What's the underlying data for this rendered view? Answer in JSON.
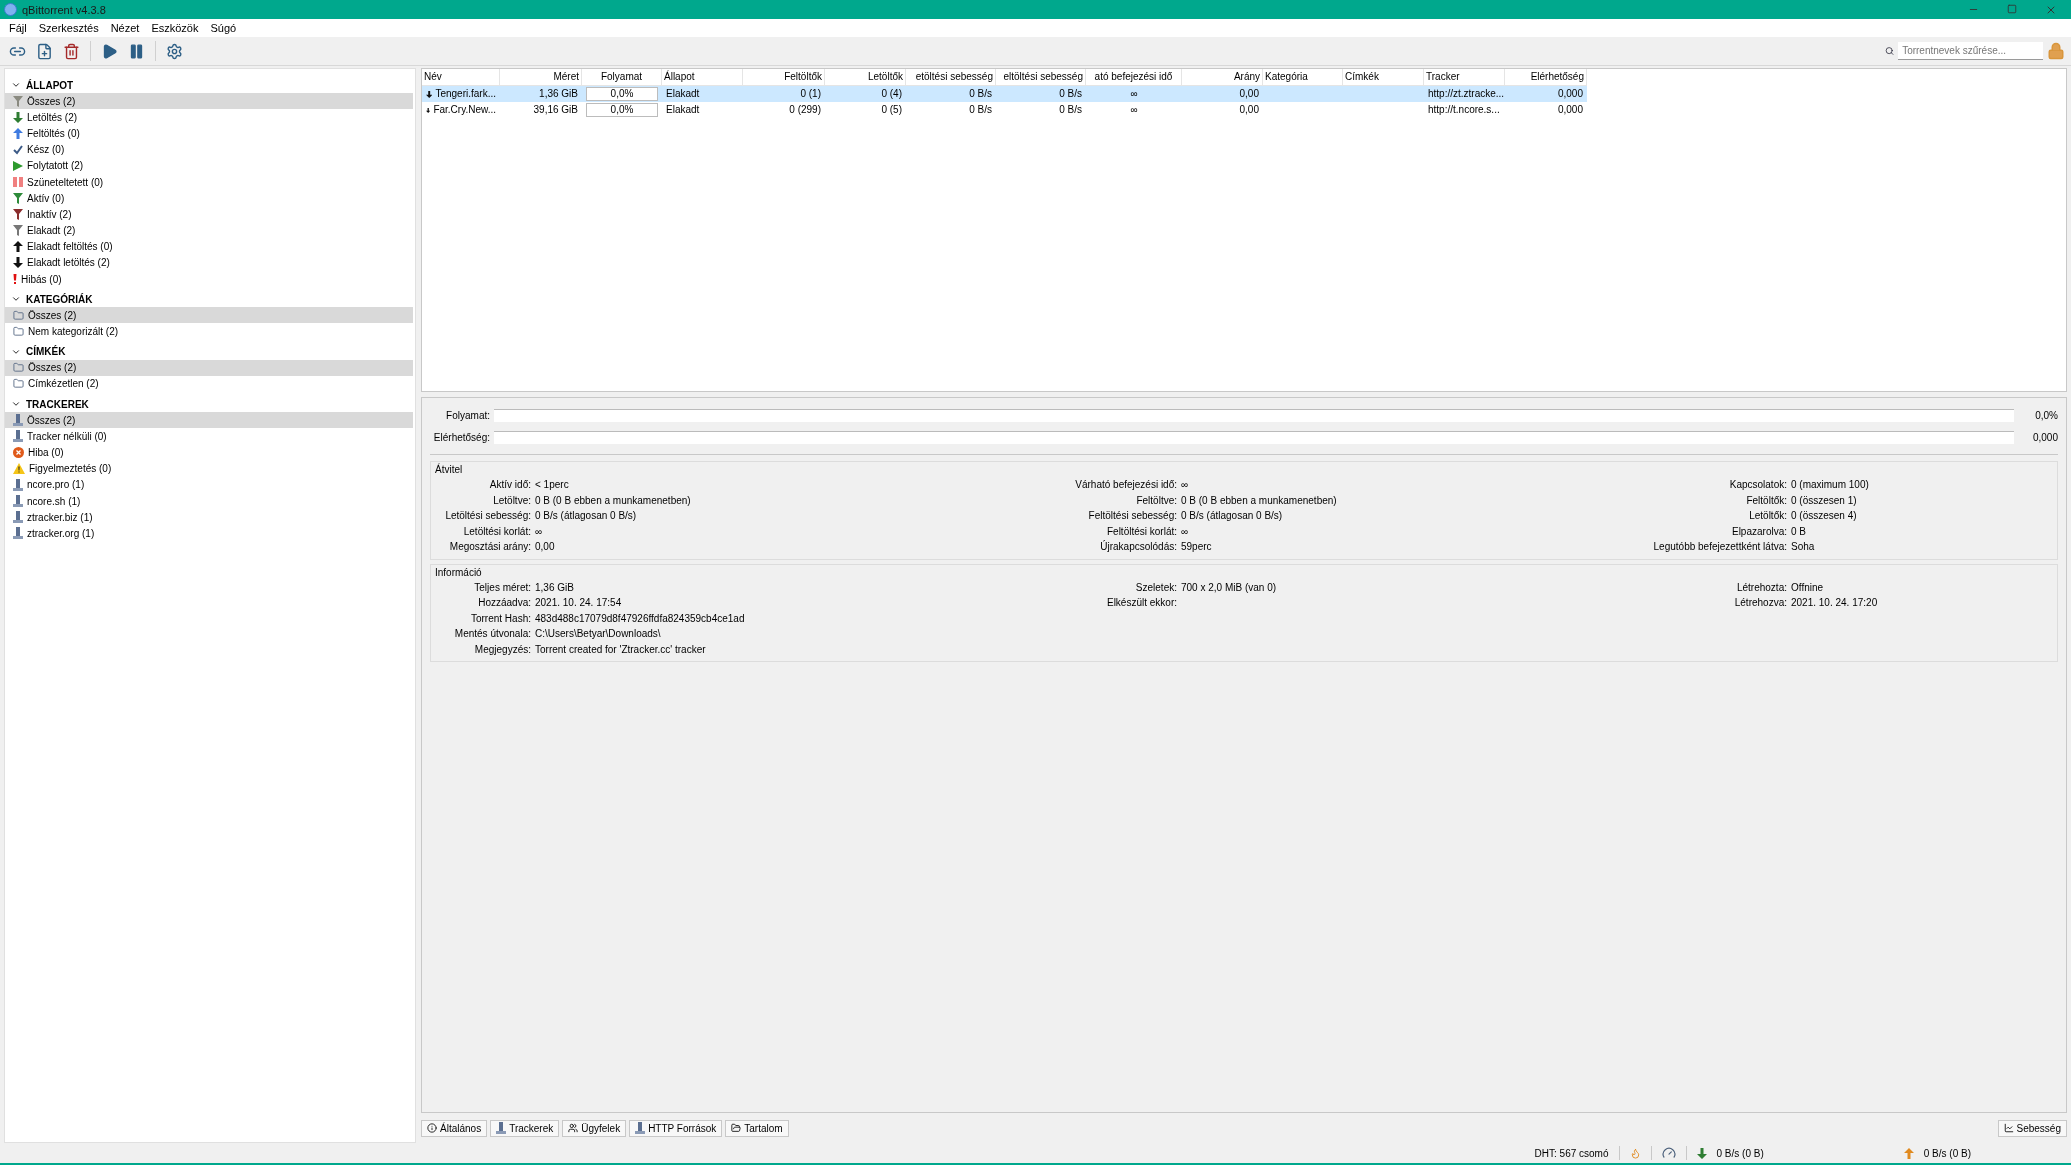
{
  "window": {
    "title": "qBittorrent v4.3.8"
  },
  "menu": [
    "Fájl",
    "Szerkesztés",
    "Nézet",
    "Eszközök",
    "Súgó"
  ],
  "toolbar": {
    "search": {
      "placeholder": "Torrentnevek szűrése..."
    }
  },
  "sidebar": {
    "sections": [
      {
        "title": "ÁLLAPOT",
        "expanded": true,
        "items": [
          {
            "label": "Összes (2)",
            "kind": "all",
            "selected": true
          },
          {
            "label": "Letöltés (2)",
            "kind": "downloading",
            "selected": false
          },
          {
            "label": "Feltöltés (0)",
            "kind": "seeding",
            "selected": false
          },
          {
            "label": "Kész (0)",
            "kind": "completed",
            "selected": false
          },
          {
            "label": "Folytatott (2)",
            "kind": "resumed",
            "selected": false
          },
          {
            "label": "Szüneteltetett (0)",
            "kind": "paused",
            "selected": false
          },
          {
            "label": "Aktív (0)",
            "kind": "active",
            "selected": false
          },
          {
            "label": "Inaktív (2)",
            "kind": "inactive",
            "selected": false
          },
          {
            "label": "Elakadt (2)",
            "kind": "stalled",
            "selected": false
          },
          {
            "label": "Elakadt feltöltés (0)",
            "kind": "stalledup",
            "selected": false
          },
          {
            "label": "Elakadt letöltés (2)",
            "kind": "stalleddown",
            "selected": false
          },
          {
            "label": "Hibás (0)",
            "kind": "errored",
            "selected": false
          }
        ]
      },
      {
        "title": "KATEGÓRIÁK",
        "expanded": true,
        "items": [
          {
            "label": "Összes (2)",
            "kind": "folder",
            "selected": true
          },
          {
            "label": "Nem kategorizált (2)",
            "kind": "folder",
            "selected": false
          }
        ]
      },
      {
        "title": "CÍMKÉK",
        "expanded": true,
        "items": [
          {
            "label": "Összes (2)",
            "kind": "folder",
            "selected": true
          },
          {
            "label": "Címkézetlen (2)",
            "kind": "folder",
            "selected": false
          }
        ]
      },
      {
        "title": "TRACKEREK",
        "expanded": true,
        "items": [
          {
            "label": "Összes (2)",
            "kind": "tracker",
            "selected": true
          },
          {
            "label": "Tracker nélküli (0)",
            "kind": "tracker",
            "selected": false
          },
          {
            "label": "Hiba (0)",
            "kind": "error",
            "selected": false
          },
          {
            "label": "Figyelmeztetés (0)",
            "kind": "warning",
            "selected": false
          },
          {
            "label": "ncore.pro (1)",
            "kind": "tracker",
            "selected": false
          },
          {
            "label": "ncore.sh (1)",
            "kind": "tracker",
            "selected": false
          },
          {
            "label": "ztracker.biz (1)",
            "kind": "tracker",
            "selected": false
          },
          {
            "label": "ztracker.org (1)",
            "kind": "tracker",
            "selected": false
          }
        ]
      }
    ]
  },
  "table": {
    "columns": [
      "Név",
      "Méret",
      "Folyamat",
      "Állapot",
      "Feltöltők",
      "Letöltők",
      "etöltési sebesség",
      "eltöltési sebesség",
      "ató befejezési idő",
      "Arány",
      "Kategória",
      "Címkék",
      "Tracker",
      "Elérhetőség"
    ],
    "rows": [
      {
        "selected": true,
        "name": "Tengeri.fark...",
        "size": "1,36 GiB",
        "progress": {
          "level": 0,
          "text": "0,0%"
        },
        "status": "Elakadt",
        "seeds": "0 (1)",
        "peers": "0 (4)",
        "down_speed": "0 B/s",
        "up_speed": "0 B/s",
        "eta": "∞",
        "ratio": "0,00",
        "tracker": "http://zt.ztracke...",
        "availability": "0,000"
      },
      {
        "selected": false,
        "name": "Far.Cry.New...",
        "size": "39,16 GiB",
        "progress": {
          "level": 0,
          "text": "0,0%"
        },
        "status": "Elakadt",
        "seeds": "0 (299)",
        "peers": "0 (5)",
        "down_speed": "0 B/s",
        "up_speed": "0 B/s",
        "eta": "∞",
        "ratio": "0,00",
        "tracker": "http://t.ncore.s...",
        "availability": "0,000"
      }
    ]
  },
  "details": {
    "bars": [
      {
        "label": "Folyamat:",
        "level": 0,
        "value": "0,0%"
      },
      {
        "label": "Elérhetőség:",
        "level": 0,
        "value": "0,000"
      }
    ],
    "groups": [
      {
        "title": "Átvitel",
        "rows": [
          [
            {
              "label": "Aktív idő:",
              "value": "< 1perc"
            },
            {
              "label": "Várható befejezési idő:",
              "value": "∞"
            },
            {
              "label": "Kapcsolatok:",
              "value": "0 (maximum 100)"
            }
          ],
          [
            {
              "label": "Letöltve:",
              "value": "0 B (0 B ebben a munkamenetben)"
            },
            {
              "label": "Feltöltve:",
              "value": "0 B (0 B ebben a munkamenetben)"
            },
            {
              "label": "Feltöltők:",
              "value": "0 (összesen 1)"
            }
          ],
          [
            {
              "label": "Letöltési sebesség:",
              "value": "0 B/s (átlagosan 0 B/s)"
            },
            {
              "label": "Feltöltési sebesség:",
              "value": "0 B/s (átlagosan 0 B/s)"
            },
            {
              "label": "Letöltők:",
              "value": "0 (összesen 4)"
            }
          ],
          [
            {
              "label": "Letöltési korlát:",
              "value": "∞"
            },
            {
              "label": "Feltöltési korlát:",
              "value": "∞"
            },
            {
              "label": "Elpazarolva:",
              "value": "0 B"
            }
          ],
          [
            {
              "label": "Megosztási arány:",
              "value": "0,00"
            },
            {
              "label": "Újrakapcsolódás:",
              "value": "59perc"
            },
            {
              "label": "Legutóbb befejezettként látva:",
              "value": "Soha"
            }
          ]
        ]
      },
      {
        "title": "Információ",
        "rows": [
          [
            {
              "label": "Teljes méret:",
              "value": "1,36 GiB"
            },
            {
              "label": "Szeletek:",
              "value": "700 x 2,0 MiB (van 0)"
            },
            {
              "label": "Létrehozta:",
              "value": "Offnine"
            }
          ],
          [
            {
              "label": "Hozzáadva:",
              "value": "2021. 10. 24. 17:54"
            },
            {
              "label": "Elkészült ekkor:"
            },
            {
              "label": "Létrehozva:",
              "value": "2021. 10. 24. 17:20"
            }
          ],
          [
            {
              "label": "Torrent Hash:",
              "value": "483d488c17079d8f47926ffdfa824359cb4ce1ad"
            }
          ],
          [
            {
              "label": "Mentés útvonala:",
              "value": "C:\\Users\\Betyar\\Downloads\\"
            }
          ],
          [
            {
              "label": "Megjegyzés:",
              "value": "Torrent created for 'Ztracker.cc' tracker"
            }
          ]
        ]
      }
    ]
  },
  "tabs": [
    {
      "label": "Általános",
      "kind": "general",
      "selected": false
    },
    {
      "label": "Trackerek",
      "kind": "trackers",
      "selected": false
    },
    {
      "label": "Ügyfelek",
      "kind": "peers",
      "selected": false
    },
    {
      "label": "HTTP Források",
      "kind": "http",
      "selected": false
    },
    {
      "label": "Tartalom",
      "kind": "content",
      "selected": false
    }
  ],
  "speed_button": "Sebesség",
  "status_bar": {
    "dht": "DHT: 567 csomó",
    "download": "0 B/s (0 B)",
    "upload": "0 B/s (0 B)"
  }
}
